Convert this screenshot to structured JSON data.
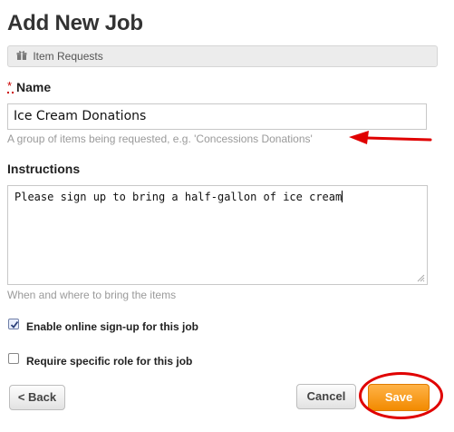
{
  "page": {
    "title": "Add New Job"
  },
  "job_type": {
    "label": "Item Requests",
    "icon": "gift-icon"
  },
  "name_field": {
    "required_marker": "*",
    "label": "Name",
    "value": "Ice Cream Donations",
    "hint": "A group of items being requested, e.g. 'Concessions Donations'"
  },
  "instructions_field": {
    "label": "Instructions",
    "value": "Please sign up to bring a half-gallon of ice cream",
    "hint": "When and where to bring the items"
  },
  "options": {
    "online_signup": {
      "label": "Enable online sign-up for this job",
      "checked": true
    },
    "specific_role": {
      "label": "Require specific role for this job",
      "checked": false
    }
  },
  "buttons": {
    "back": "< Back",
    "cancel": "Cancel",
    "save": "Save"
  },
  "annotations": {
    "arrow_color": "#e00000",
    "ring_color": "#e00000"
  }
}
